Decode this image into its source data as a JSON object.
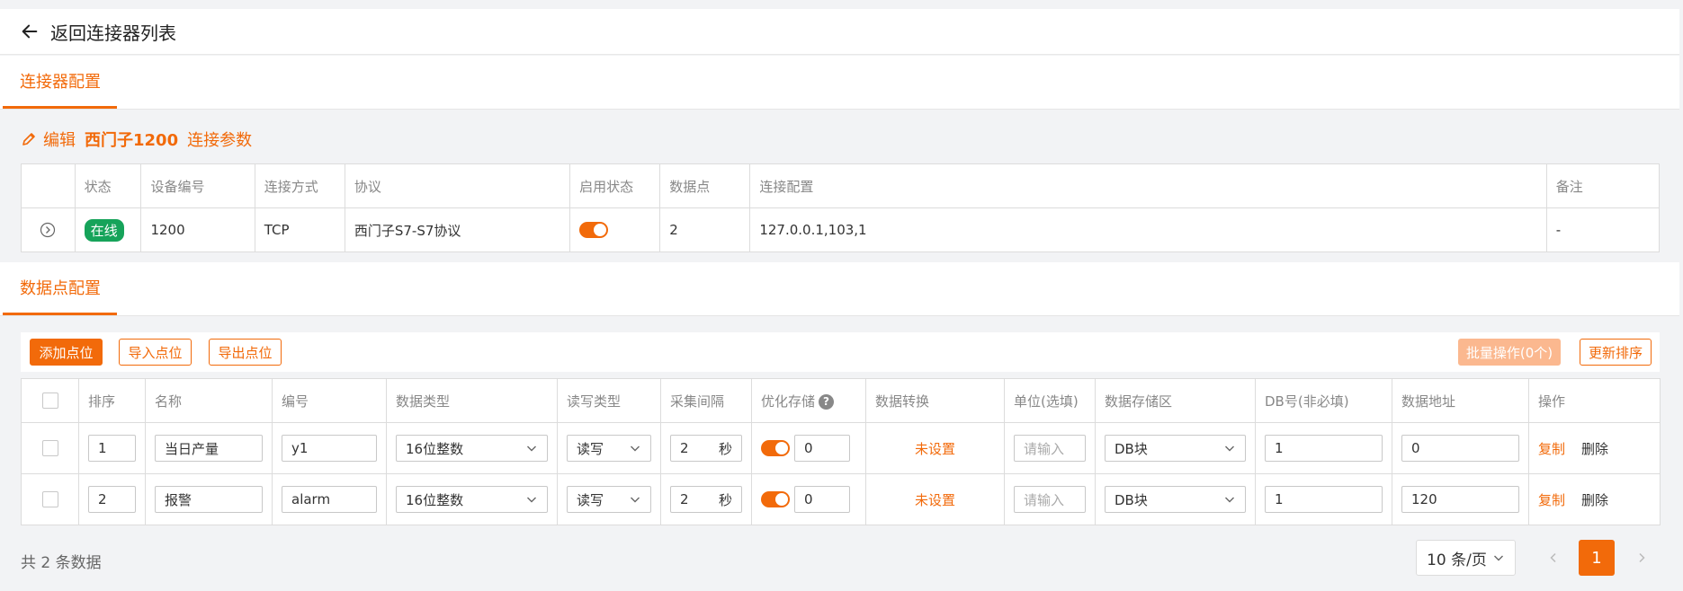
{
  "header": {
    "back_label": "返回连接器列表"
  },
  "tabs": {
    "connector_config": "连接器配置",
    "datapoint_config": "数据点配置"
  },
  "edit": {
    "prefix": "编辑",
    "device_name": "西门子1200",
    "suffix": "连接参数"
  },
  "connector_table": {
    "headers": [
      "状态",
      "设备编号",
      "连接方式",
      "协议",
      "启用状态",
      "数据点",
      "连接配置",
      "备注"
    ],
    "row": {
      "status": "在线",
      "device_no": "1200",
      "conn_type": "TCP",
      "protocol": "西门子S7-S7协议",
      "enabled": true,
      "points": "2",
      "config": "127.0.0.1,103,1",
      "remark": "-"
    }
  },
  "toolbar": {
    "add": "添加点位",
    "import": "导入点位",
    "export": "导出点位",
    "batch": "批量操作(0个)",
    "reorder": "更新排序"
  },
  "points_table": {
    "headers": [
      "排序",
      "名称",
      "编号",
      "数据类型",
      "读写类型",
      "采集间隔",
      "优化存储",
      "数据转换",
      "单位(选填)",
      "数据存储区",
      "DB号(非必填)",
      "数据地址",
      "操作"
    ],
    "help_icon": "?",
    "rows": [
      {
        "order": "1",
        "name": "当日产量",
        "code": "y1",
        "dtype": "16位整数",
        "rw": "读写",
        "interval": "2",
        "interval_unit": "秒",
        "opt_enabled": true,
        "opt_value": "0",
        "convert": "未设置",
        "unit_placeholder": "请输入",
        "area": "DB块",
        "db": "1",
        "addr": "0",
        "copy": "复制",
        "delete": "删除"
      },
      {
        "order": "2",
        "name": "报警",
        "code": "alarm",
        "dtype": "16位整数",
        "rw": "读写",
        "interval": "2",
        "interval_unit": "秒",
        "opt_enabled": true,
        "opt_value": "0",
        "convert": "未设置",
        "unit_placeholder": "请输入",
        "area": "DB块",
        "db": "1",
        "addr": "120",
        "copy": "复制",
        "delete": "删除"
      }
    ]
  },
  "footer": {
    "total": "共 2 条数据",
    "page_size": "10 条/页",
    "current_page": "1"
  },
  "colors": {
    "accent": "#f26a0a",
    "online": "#16a35a",
    "disabled_btn": "#fbb88f"
  }
}
